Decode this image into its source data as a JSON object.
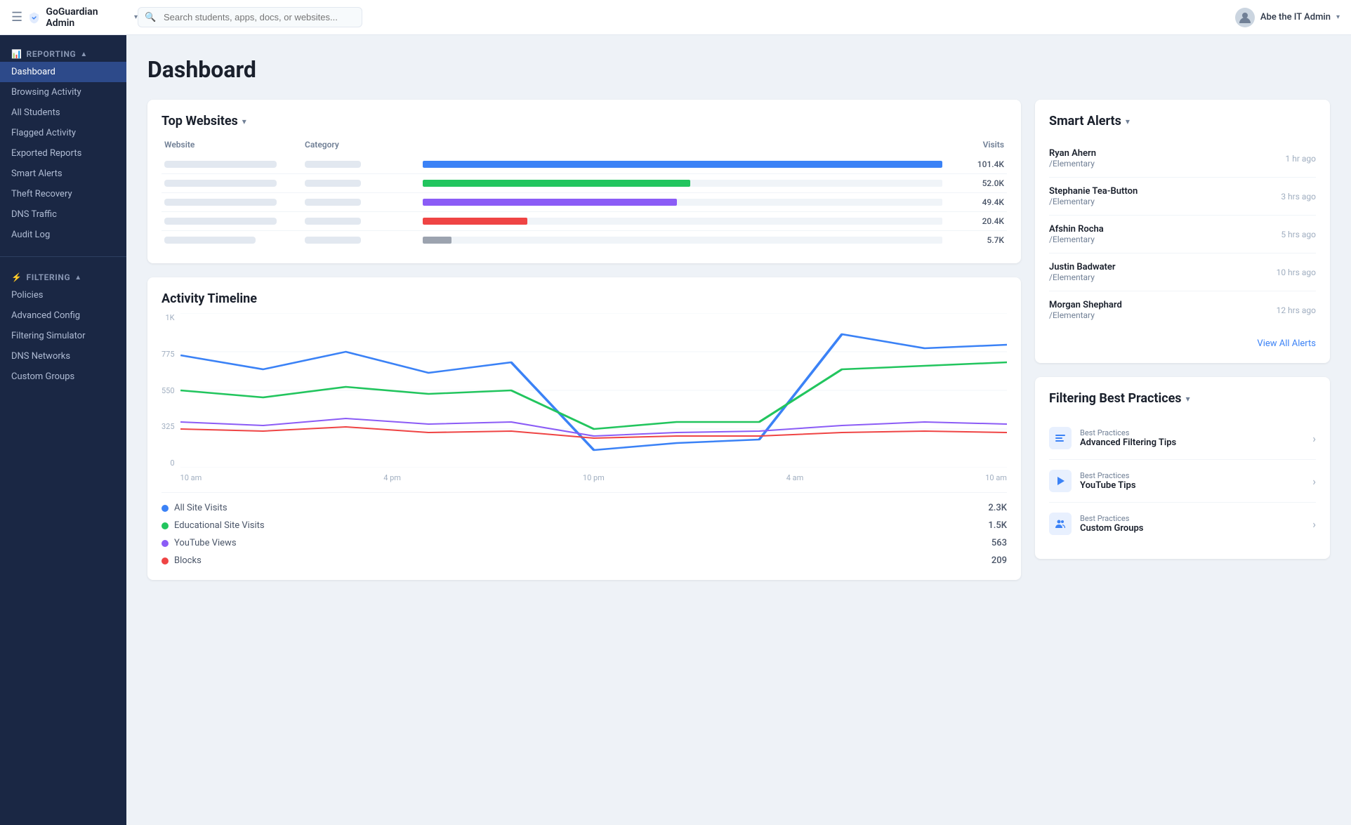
{
  "topbar": {
    "logo": "GoGuardian Admin",
    "logo_chevron": "▾",
    "search_placeholder": "Search students, apps, docs, or websites...",
    "user_name": "Abe the IT Admin",
    "user_chevron": "▾"
  },
  "sidebar": {
    "reporting_label": "Reporting",
    "reporting_icon": "📊",
    "items_reporting": [
      {
        "label": "Dashboard",
        "active": true
      },
      {
        "label": "Browsing Activity",
        "active": false
      },
      {
        "label": "All Students",
        "active": false
      },
      {
        "label": "Flagged Activity",
        "active": false
      },
      {
        "label": "Exported Reports",
        "active": false
      },
      {
        "label": "Smart Alerts",
        "active": false
      },
      {
        "label": "Theft Recovery",
        "active": false
      },
      {
        "label": "DNS Traffic",
        "active": false
      },
      {
        "label": "Audit Log",
        "active": false
      }
    ],
    "filtering_label": "Filtering",
    "items_filtering": [
      {
        "label": "Policies",
        "active": false
      },
      {
        "label": "Advanced Config",
        "active": false
      },
      {
        "label": "Filtering Simulator",
        "active": false
      },
      {
        "label": "DNS Networks",
        "active": false
      },
      {
        "label": "Custom Groups",
        "active": false
      }
    ]
  },
  "dashboard": {
    "title": "Dashboard"
  },
  "top_websites": {
    "title": "Top Websites",
    "chevron": "▾",
    "columns": [
      "Website",
      "Category",
      "",
      "Visits"
    ],
    "rows": [
      {
        "bar_color": "#3b82f6",
        "bar_width": "100%",
        "visits": "101.4K"
      },
      {
        "bar_color": "#22c55e",
        "bar_width": "51.5%",
        "visits": "52.0K"
      },
      {
        "bar_color": "#8b5cf6",
        "bar_width": "48.9%",
        "visits": "49.4K"
      },
      {
        "bar_color": "#ef4444",
        "bar_width": "20.2%",
        "visits": "20.4K"
      },
      {
        "bar_color": "#6b7280",
        "bar_width": "5.6%",
        "visits": "5.7K"
      }
    ]
  },
  "activity_timeline": {
    "title": "Activity Timeline",
    "y_labels": [
      "1K",
      "775",
      "550",
      "325",
      "0"
    ],
    "x_labels": [
      "10 am",
      "4 pm",
      "10 pm",
      "4 am",
      "10 am"
    ],
    "legend": [
      {
        "label": "All Site Visits",
        "color": "#3b82f6",
        "value": "2.3K"
      },
      {
        "label": "Educational Site Visits",
        "color": "#22c55e",
        "value": "1.5K"
      },
      {
        "label": "YouTube Views",
        "color": "#8b5cf6",
        "value": "563"
      },
      {
        "label": "Blocks",
        "color": "#ef4444",
        "value": "209"
      }
    ]
  },
  "smart_alerts": {
    "title": "Smart Alerts",
    "chevron": "▾",
    "alerts": [
      {
        "name": "Ryan Ahern",
        "school": "/Elementary",
        "time": "1 hr ago"
      },
      {
        "name": "Stephanie Tea-Button",
        "school": "/Elementary",
        "time": "3 hrs ago"
      },
      {
        "name": "Afshin Rocha",
        "school": "/Elementary",
        "time": "5 hrs ago"
      },
      {
        "name": "Justin Badwater",
        "school": "/Elementary",
        "time": "10 hrs ago"
      },
      {
        "name": "Morgan Shephard",
        "school": "/Elementary",
        "time": "12 hrs ago"
      }
    ],
    "view_all_label": "View All Alerts"
  },
  "filtering_best_practices": {
    "title": "Filtering Best Practices",
    "chevron": "▾",
    "items": [
      {
        "icon_type": "lines",
        "label": "Best Practices",
        "title": "Advanced Filtering Tips"
      },
      {
        "icon_type": "play",
        "label": "Best Practices",
        "title": "YouTube Tips"
      },
      {
        "icon_type": "people",
        "label": "Best Practices",
        "title": "Custom Groups"
      }
    ]
  }
}
